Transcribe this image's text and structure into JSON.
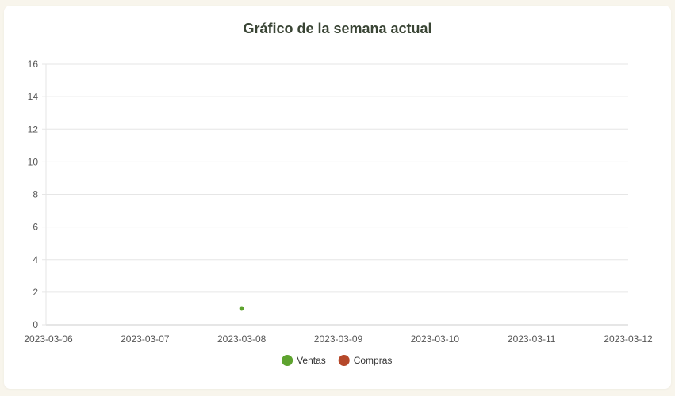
{
  "colors": {
    "ventas": "#5ea32f",
    "compras": "#b5482a",
    "grid": "#e6e6e6",
    "axis": "#cccccc"
  },
  "chart_data": {
    "type": "line",
    "title": "Gráfico de la semana actual",
    "xlabel": "",
    "ylabel": "",
    "x": [
      "2023-03-06",
      "2023-03-07",
      "2023-03-08",
      "2023-03-09",
      "2023-03-10",
      "2023-03-11",
      "2023-03-12"
    ],
    "ylim": [
      0,
      16
    ],
    "yticks": [
      "0",
      "2",
      "4",
      "6",
      "8",
      "10",
      "12",
      "14",
      "16"
    ],
    "grid": true,
    "legend_position": "bottom",
    "series": [
      {
        "name": "Ventas",
        "color": "#5ea32f",
        "points": [
          {
            "x": "2023-03-08",
            "y": 1
          }
        ]
      },
      {
        "name": "Compras",
        "color": "#b5482a",
        "points": []
      }
    ]
  }
}
